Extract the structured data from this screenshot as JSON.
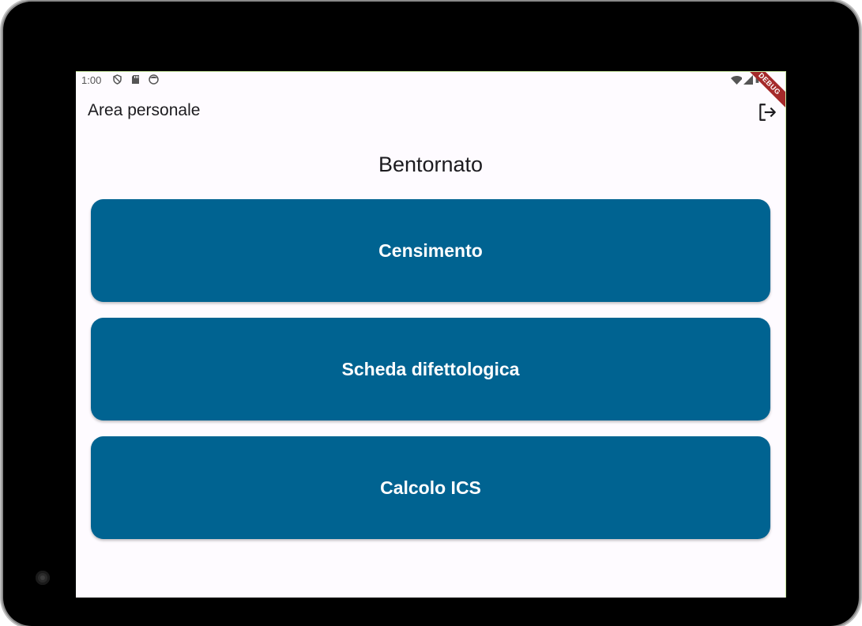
{
  "status_bar": {
    "time": "1:00",
    "icons_left": [
      "shield-icon",
      "sd-card-icon",
      "face-icon"
    ],
    "icons_right": [
      "wifi-icon",
      "signal-icon",
      "battery-icon"
    ]
  },
  "debug_banner": "DEBUG",
  "app_bar": {
    "title": "Area personale",
    "action_icon": "logout-icon"
  },
  "main": {
    "welcome": "Bentornato",
    "buttons": [
      {
        "label": "Censimento"
      },
      {
        "label": "Scheda difettologica"
      },
      {
        "label": "Calcolo ICS"
      }
    ]
  },
  "colors": {
    "primary_button": "#006391",
    "background": "#fefbff",
    "text": "#1c1b1f"
  }
}
